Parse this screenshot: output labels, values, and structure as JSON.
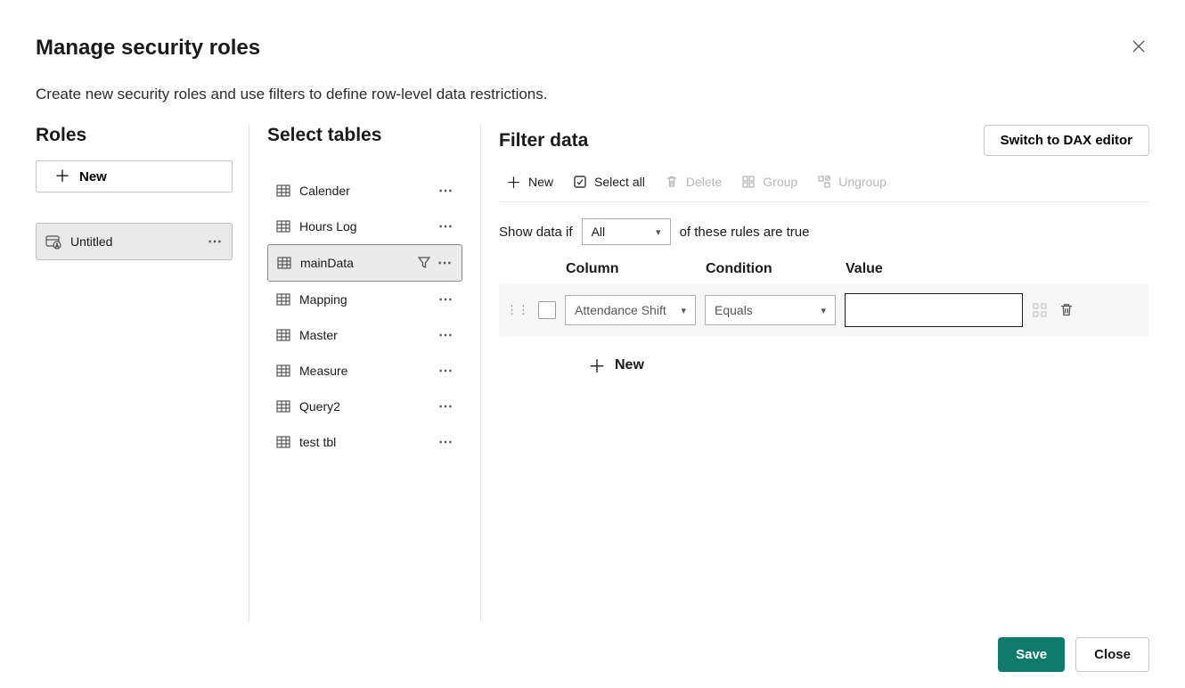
{
  "dialog": {
    "title": "Manage security roles",
    "subtitle": "Create new security roles and use filters to define row-level data restrictions.",
    "close_icon": "close-icon"
  },
  "roles": {
    "title": "Roles",
    "new_label": "New",
    "items": [
      {
        "name": "Untitled",
        "selected": true
      }
    ]
  },
  "tables": {
    "title": "Select tables",
    "items": [
      {
        "name": "Calender",
        "selected": false,
        "filtered": false
      },
      {
        "name": "Hours Log",
        "selected": false,
        "filtered": false
      },
      {
        "name": "mainData",
        "selected": true,
        "filtered": true
      },
      {
        "name": "Mapping",
        "selected": false,
        "filtered": false
      },
      {
        "name": "Master",
        "selected": false,
        "filtered": false
      },
      {
        "name": "Measure",
        "selected": false,
        "filtered": false
      },
      {
        "name": "Query2",
        "selected": false,
        "filtered": false
      },
      {
        "name": "test tbl",
        "selected": false,
        "filtered": false
      }
    ]
  },
  "filter": {
    "title": "Filter data",
    "switch_dax_label": "Switch to DAX editor",
    "toolbar": {
      "new": "New",
      "select_all": "Select all",
      "delete": "Delete",
      "group": "Group",
      "ungroup": "Ungroup"
    },
    "show_data_prefix": "Show data if",
    "show_data_select": "All",
    "show_data_suffix": "of these rules are true",
    "headers": {
      "column": "Column",
      "condition": "Condition",
      "value": "Value"
    },
    "rules": [
      {
        "column": "Attendance Shift",
        "condition": "Equals",
        "value": ""
      }
    ],
    "add_new_label": "New"
  },
  "footer": {
    "save": "Save",
    "close": "Close"
  }
}
